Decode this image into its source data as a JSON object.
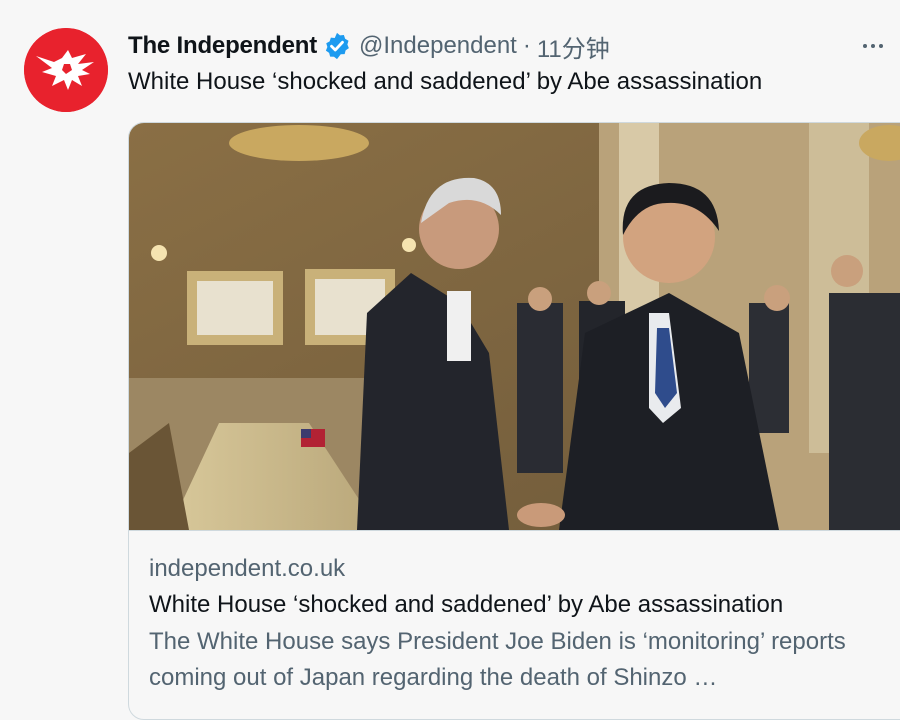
{
  "tweet": {
    "author_name": "The Independent",
    "handle": "@Independent",
    "separator": "·",
    "time": "11分钟",
    "text": "White House ‘shocked and saddened’ by Abe assassination"
  },
  "icons": {
    "avatar": "independent-eagle-logo",
    "verified": "verified-badge-icon",
    "more": "more-options-icon"
  },
  "colors": {
    "brand_red": "#e8222d",
    "verified_blue": "#1d9bf0",
    "secondary_text": "#536471"
  },
  "card": {
    "domain": "independent.co.uk",
    "title": "White House ‘shocked and saddened’ by Abe assassination",
    "description": "The White House says President Joe Biden is ‘monitoring’ reports coming out of Japan regarding the death of Shinzo …"
  }
}
